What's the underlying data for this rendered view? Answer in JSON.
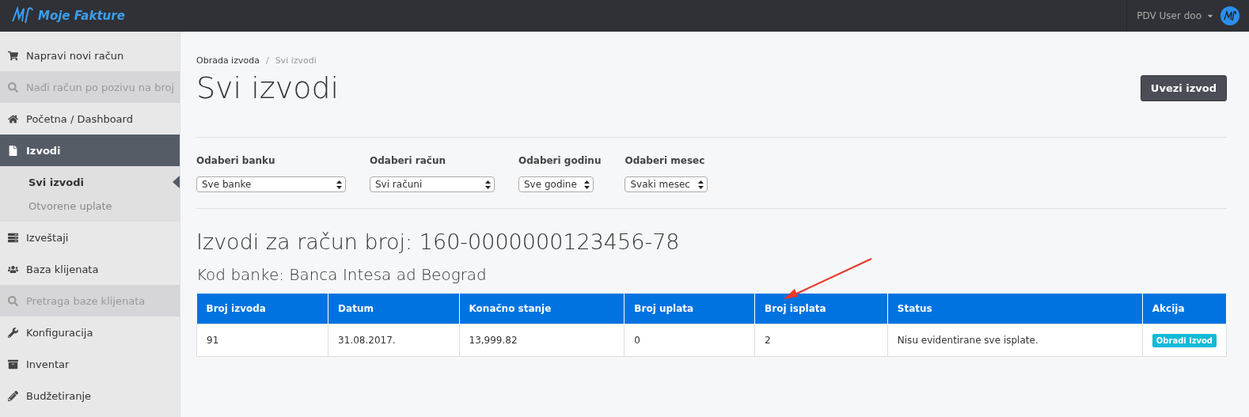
{
  "topbar": {
    "brand": "Moje Fakture",
    "user": "PDV User doo"
  },
  "sidebar": {
    "items": [
      {
        "kind": "link",
        "label": "Napravi novi račun",
        "selected": false
      },
      {
        "kind": "search",
        "label": "Nađi račun po pozivu na broj",
        "selected": false
      },
      {
        "kind": "link",
        "label": "Početna / Dashboard",
        "selected": false
      },
      {
        "kind": "link",
        "label": "Izvodi",
        "selected": true,
        "expanded": true,
        "children": [
          {
            "label": "Svi izvodi",
            "selected": true
          },
          {
            "label": "Otvorene uplate",
            "selected": false
          }
        ]
      },
      {
        "kind": "link",
        "label": "Izveštaji",
        "selected": false
      },
      {
        "kind": "link",
        "label": "Baza klijenata",
        "selected": false
      },
      {
        "kind": "search",
        "label": "Pretraga baze klijenata",
        "selected": false
      },
      {
        "kind": "link",
        "label": "Konfiguracija",
        "selected": false
      },
      {
        "kind": "link",
        "label": "Inventar",
        "selected": false
      },
      {
        "kind": "link",
        "label": "Budžetiranje",
        "selected": false
      }
    ]
  },
  "breadcrumb": {
    "separator": "/",
    "items": [
      {
        "label": "Obrada izvoda",
        "selected": false
      },
      {
        "label": "Svi izvodi",
        "selected": true
      }
    ]
  },
  "page_title": "Svi izvodi",
  "import_button": "Uvezi izvod",
  "filters": [
    {
      "label": "Odaberi banku",
      "value": "Sve banke"
    },
    {
      "label": "Odaberi račun",
      "value": "Svi računi"
    },
    {
      "label": "Odaberi godinu",
      "value": "Sve godine"
    },
    {
      "label": "Odaberi mesec",
      "value": "Svaki mesec"
    }
  ],
  "account_heading": "Izvodi za račun broj: 160-0000000123456-78",
  "bank_heading": "Kod banke: Banca Intesa ad Beograd",
  "table": {
    "columns": [
      "Broj izvoda",
      "Datum",
      "Konačno stanje",
      "Broj uplata",
      "Broj isplata",
      "Status",
      "Akcija"
    ],
    "rows": [
      {
        "cells": [
          "91",
          "31.08.2017.",
          "13,999.82",
          "0",
          "2",
          "Nisu evidentirane sve isplate."
        ],
        "action": "Obradi izvod"
      }
    ]
  }
}
